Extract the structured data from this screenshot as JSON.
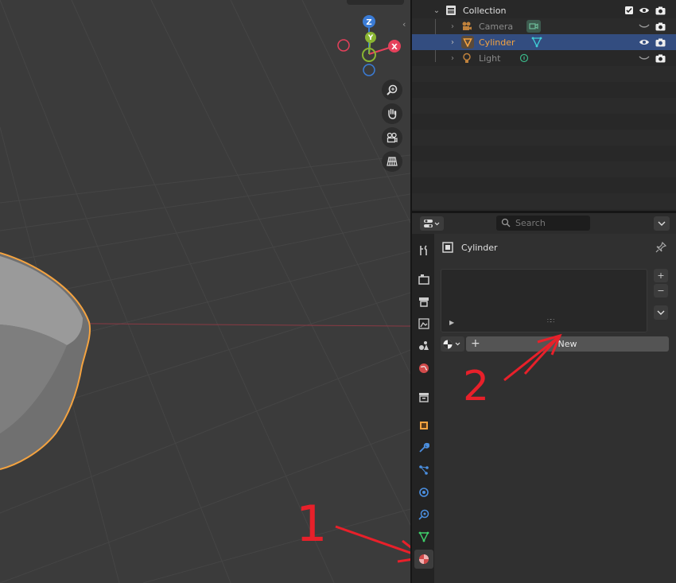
{
  "viewport": {
    "gizmo": {
      "z_label": "Z",
      "y_label": "Y",
      "x_label": "X"
    },
    "nav_tools": [
      "zoom-icon",
      "hand-pan-icon",
      "camera-view-icon",
      "ortho-grid-icon"
    ]
  },
  "outliner": {
    "collection": {
      "label": "Collection"
    },
    "items": [
      {
        "label": "Camera",
        "icon": "camera-object-icon",
        "selected": false
      },
      {
        "label": "Cylinder",
        "icon": "mesh-object-icon",
        "selected": true
      },
      {
        "label": "Light",
        "icon": "light-object-icon",
        "selected": false
      }
    ]
  },
  "properties": {
    "search_placeholder": "Search",
    "object_name": "Cylinder",
    "new_button": "New",
    "add_slot": "+",
    "remove_slot": "−",
    "tabs": [
      "tool",
      "render",
      "output",
      "view-layer",
      "scene",
      "world",
      "collection",
      "object",
      "modifiers",
      "particles",
      "physics",
      "constraints",
      "data",
      "material"
    ],
    "active_tab": "material"
  },
  "annotations": {
    "label_1": "1",
    "label_2": "2",
    "color": "#e8202a"
  },
  "colors": {
    "selection": "#334d80",
    "accent_orange": "#f4a340",
    "axis_x": "#e5415b",
    "axis_y": "#8ab532",
    "axis_z": "#3b7cd6"
  }
}
